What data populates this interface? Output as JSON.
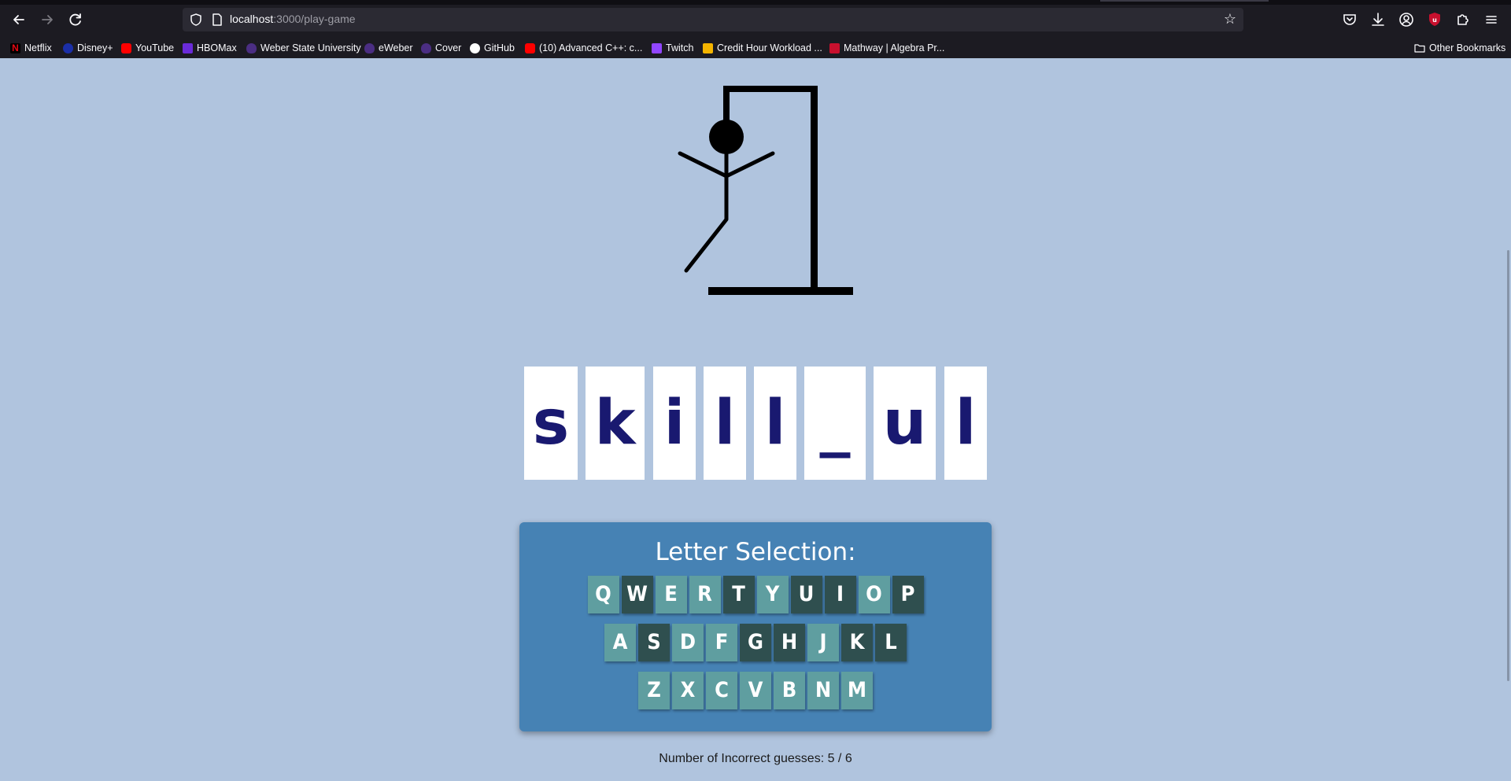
{
  "browser": {
    "url_host": "localhost",
    "url_path": ":3000/play-game",
    "bookmarks": [
      {
        "label": "Netflix",
        "color": "#e50914"
      },
      {
        "label": "Disney+",
        "color": "#1b2fa8"
      },
      {
        "label": "YouTube",
        "color": "#ff0000"
      },
      {
        "label": "HBOMax",
        "color": "#6a2bd9"
      },
      {
        "label": "Weber State University",
        "color": "#4b2e83"
      },
      {
        "label": "eWeber",
        "color": "#4b2e83"
      },
      {
        "label": "Cover",
        "color": "#4b2e83"
      },
      {
        "label": "GitHub",
        "color": "#ffffff"
      },
      {
        "label": "(10) Advanced C++: c...",
        "color": "#ff0000"
      },
      {
        "label": "Twitch",
        "color": "#9146ff"
      },
      {
        "label": "Credit Hour Workload ...",
        "color": "#f4b400"
      },
      {
        "label": "Mathway | Algebra Pr...",
        "color": "#c8102e"
      }
    ],
    "other_bookmarks": "Other Bookmarks"
  },
  "game": {
    "word_tiles": [
      "s",
      "k",
      "i",
      "l",
      "l",
      "_",
      "u",
      "l"
    ],
    "panel_title": "Letter Selection:",
    "keyboard_rows": [
      [
        "Q",
        "W",
        "E",
        "R",
        "T",
        "Y",
        "U",
        "I",
        "O",
        "P"
      ],
      [
        "A",
        "S",
        "D",
        "F",
        "G",
        "H",
        "J",
        "K",
        "L"
      ],
      [
        "Z",
        "X",
        "C",
        "V",
        "B",
        "N",
        "M"
      ]
    ],
    "used_letters": [
      "W",
      "T",
      "U",
      "I",
      "P",
      "S",
      "G",
      "H",
      "K",
      "L"
    ],
    "incorrect_label": "Number of Incorrect guesses: 5 / 6",
    "incorrect_count": 5,
    "max_incorrect": 6,
    "colors": {
      "background": "#b0c4de",
      "panel": "#4682b4",
      "key_available": "#5f9ea0",
      "key_used": "#2f4f4f",
      "tile_text": "#191970"
    }
  }
}
